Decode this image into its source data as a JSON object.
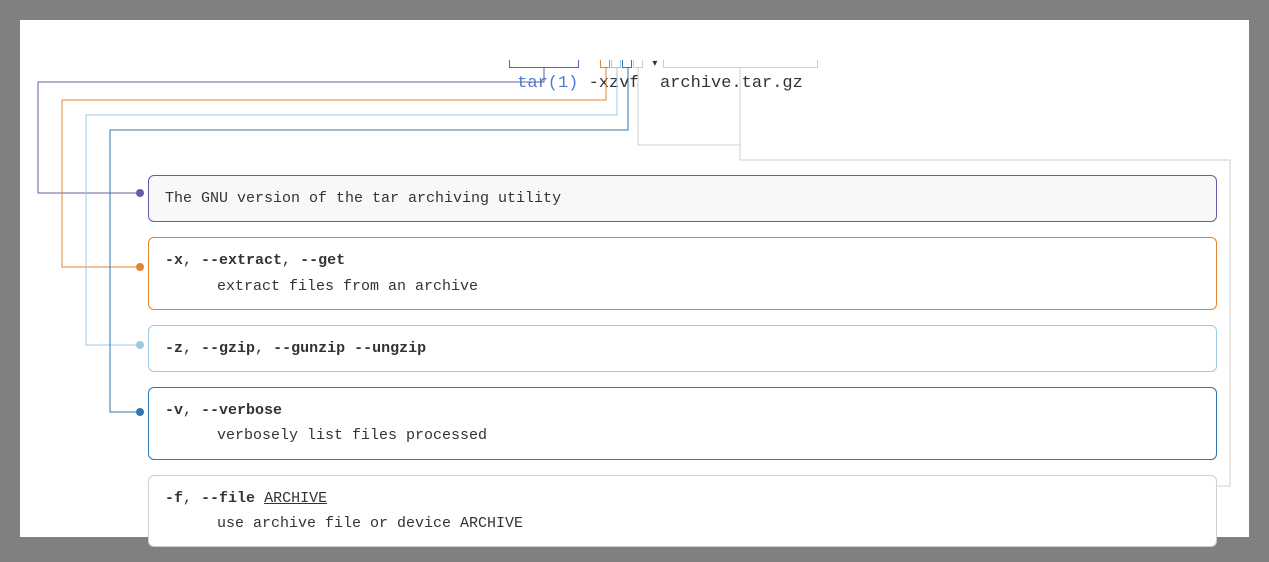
{
  "command": {
    "dropdown_glyph": "▾",
    "name": "tar(1)",
    "flags": "-xzvf",
    "arg": "archive.tar.gz"
  },
  "colors": {
    "purple": "#6b5aa8",
    "orange": "#e1862e",
    "lightblue": "#9fc9e3",
    "blue": "#2e77b3",
    "grey": "#cfcfcf"
  },
  "cards": [
    {
      "id": "summary",
      "color_key": "purple",
      "summary": "The GNU version of the tar archiving utility"
    },
    {
      "id": "x",
      "color_key": "orange",
      "flags": [
        {
          "text": "-x",
          "bold": true
        },
        {
          "text": ", "
        },
        {
          "text": "--extract",
          "bold": true
        },
        {
          "text": ", "
        },
        {
          "text": "--get",
          "bold": true
        }
      ],
      "desc": "extract files from an archive"
    },
    {
      "id": "z",
      "color_key": "lightblue",
      "flags": [
        {
          "text": "-z",
          "bold": true
        },
        {
          "text": ", "
        },
        {
          "text": "--gzip",
          "bold": true
        },
        {
          "text": ", "
        },
        {
          "text": "--gunzip",
          "bold": true
        },
        {
          "text": " "
        },
        {
          "text": "--ungzip",
          "bold": true
        }
      ]
    },
    {
      "id": "v",
      "color_key": "blue",
      "flags": [
        {
          "text": "-v",
          "bold": true
        },
        {
          "text": ", "
        },
        {
          "text": "--verbose",
          "bold": true
        }
      ],
      "desc": "verbosely list files processed"
    },
    {
      "id": "f",
      "color_key": "grey",
      "flags": [
        {
          "text": "-f",
          "bold": true
        },
        {
          "text": ", "
        },
        {
          "text": "--file",
          "bold": true
        },
        {
          "text": " "
        },
        {
          "text": "ARCHIVE",
          "underline": true
        }
      ],
      "desc": "use archive file or device ARCHIVE"
    }
  ]
}
